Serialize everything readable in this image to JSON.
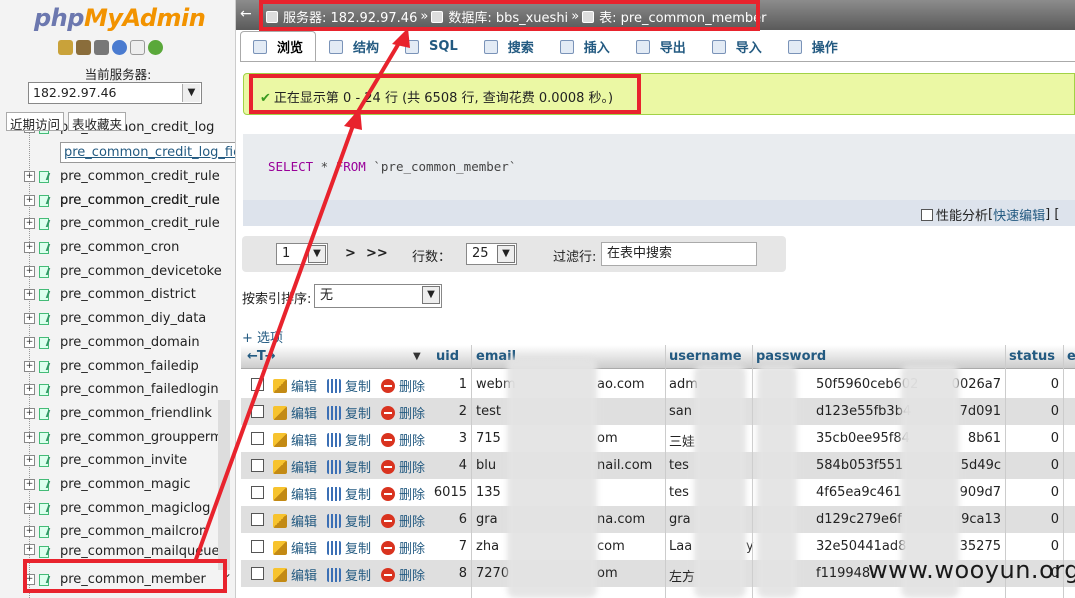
{
  "app": {
    "logo_php": "php",
    "logo_myadmin": "MyAdmin"
  },
  "sidebar": {
    "server_label": "当前服务器:",
    "server_value": "182.92.97.46",
    "tabs": [
      "近期访问",
      "表收藏夹"
    ],
    "tooltip": "pre_common_credit_log_field",
    "tables": [
      "pre_common_credit_log",
      "pre_common_credit_log_field",
      "pre_common_credit_rule",
      "pre_common_credit_rule",
      "pre_common_credit_rule",
      "pre_common_cron",
      "pre_common_devicetoke",
      "pre_common_district",
      "pre_common_diy_data",
      "pre_common_domain",
      "pre_common_failedip",
      "pre_common_failedlogin",
      "pre_common_friendlink",
      "pre_common_groupperm",
      "pre_common_invite",
      "pre_common_magic",
      "pre_common_magiclog",
      "pre_common_mailcron",
      "pre_common_mailqueue",
      "pre_common_member"
    ]
  },
  "breadcrumb": {
    "server": "服务器: 182.92.97.46",
    "database": "数据库: bbs_xueshi",
    "table": "表: pre_common_member",
    "sep": "»"
  },
  "tabs": [
    "浏览",
    "结构",
    "SQL",
    "搜索",
    "插入",
    "导出",
    "导入",
    "操作"
  ],
  "message": "正在显示第 0 - 24 行 (共 6508 行, 查询花费 0.0008 秒。)",
  "sql": {
    "kw1": "SELECT",
    "star": " * ",
    "kw2": "FROM",
    "table": " `pre_common_member`"
  },
  "sql_options": {
    "perf": "性能分析",
    "bracket_open": "[",
    "quick_edit": "快速编辑",
    "bracket_close": "] ["
  },
  "nav": {
    "page": "1",
    "next": ">",
    "last": ">>",
    "rows_label": "行数：",
    "rows_value": "25",
    "filter_label": "过滤行:",
    "filter_placeholder": "在表中搜索"
  },
  "sort": {
    "label": "按索引排序:",
    "value": "无"
  },
  "options_link": "+ 选项",
  "table": {
    "columns": [
      "uid",
      "email",
      "username",
      "password",
      "status",
      "e"
    ],
    "actions": {
      "edit": "编辑",
      "copy": "复制",
      "delete": "删除"
    },
    "rows": [
      {
        "uid": "1",
        "email": "webm",
        "email2": "ao.com",
        "username": "adm",
        "password": "50f5960ceb602",
        "password2": "0026a7",
        "status": "0"
      },
      {
        "uid": "2",
        "email": "test",
        "email2": "",
        "username": "san",
        "password": "d123e55fb3b4",
        "password2": "7d091",
        "status": "0"
      },
      {
        "uid": "3",
        "email": "715",
        "email2": "om",
        "username": "三娃",
        "password": "35cb0ee95f84",
        "password2": "8b61",
        "status": "0"
      },
      {
        "uid": "4",
        "email": "blu",
        "email2": "nail.com",
        "username": "tes",
        "password": "584b053f551",
        "password2": "5d49c",
        "status": "0"
      },
      {
        "uid": "6015",
        "email": "135",
        "email2": "",
        "username": "tes",
        "password": "4f65ea9c461",
        "password2": "909d7",
        "status": "0"
      },
      {
        "uid": "6",
        "email": "gra",
        "email2": "na.com",
        "username": "gra",
        "password": "d129c279e6f",
        "password2": "9ca13",
        "status": "0"
      },
      {
        "uid": "7",
        "email": "zha",
        "email2": "com",
        "username": "Laa",
        "username2": "y",
        "password": "32e50441ad8",
        "password2": "35275",
        "status": "0"
      },
      {
        "uid": "8",
        "email": "7270",
        "email2": "om",
        "username": "左方",
        "password": "f119948",
        "password2": "",
        "status": "0"
      }
    ]
  },
  "watermark": "www.wooyun.org",
  "colors": {
    "highlight": "#e8232d",
    "success_bg": "#ebf8a4",
    "link": "#235a81"
  }
}
